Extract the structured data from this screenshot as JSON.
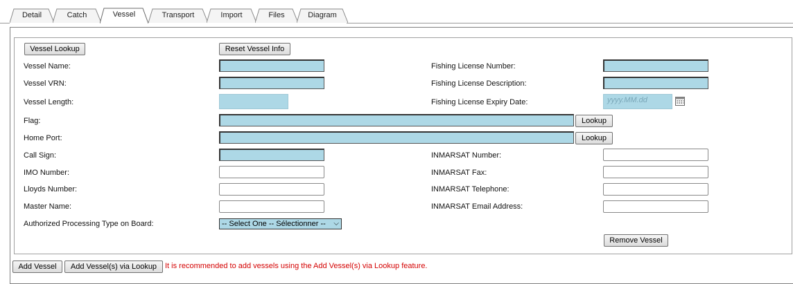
{
  "tabs": [
    {
      "label": "Detail"
    },
    {
      "label": "Catch"
    },
    {
      "label": "Vessel",
      "active": true
    },
    {
      "label": "Transport"
    },
    {
      "label": "Import"
    },
    {
      "label": "Files"
    },
    {
      "label": "Diagram"
    }
  ],
  "buttons": {
    "vessel_lookup": "Vessel Lookup",
    "reset_vessel_info": "Reset Vessel Info",
    "lookup": "Lookup",
    "remove_vessel": "Remove Vessel",
    "add_vessel": "Add Vessel",
    "add_vessels_via_lookup": "Add Vessel(s) via Lookup"
  },
  "labels": {
    "vessel_name": "Vessel Name:",
    "vessel_vrn": "Vessel VRN:",
    "vessel_length": "Vessel Length:",
    "flag": "Flag:",
    "home_port": "Home Port:",
    "call_sign": "Call Sign:",
    "imo_number": "IMO Number:",
    "lloyds_number": "Lloyds Number:",
    "master_name": "Master Name:",
    "authorized_processing": "Authorized Processing Type on Board:",
    "fishing_license_number": "Fishing License Number:",
    "fishing_license_description": "Fishing License Description:",
    "fishing_license_expiry": "Fishing License Expiry Date:",
    "inmarsat_number": "INMARSAT Number:",
    "inmarsat_fax": "INMARSAT Fax:",
    "inmarsat_telephone": "INMARSAT Telephone:",
    "inmarsat_email": "INMARSAT Email Address:"
  },
  "fields": {
    "vessel_name": "",
    "vessel_vrn": "",
    "vessel_length": "",
    "flag": "",
    "home_port": "",
    "call_sign": "",
    "imo_number": "",
    "lloyds_number": "",
    "master_name": "",
    "fishing_license_number": "",
    "fishing_license_description": "",
    "fishing_license_expiry_placeholder": "yyyy.MM.dd",
    "inmarsat_number": "",
    "inmarsat_fax": "",
    "inmarsat_telephone": "",
    "inmarsat_email": ""
  },
  "processing_type_select": "-- Select One -- Sélectionner --",
  "recommendation_note": "It is recommended to add vessels using the Add Vessel(s) via Lookup feature.",
  "colors": {
    "required_field": "#add8e6",
    "note_text": "#d40000"
  },
  "icons": {
    "calendar": "calendar-icon",
    "dropdown": "chevron-down-icon"
  }
}
